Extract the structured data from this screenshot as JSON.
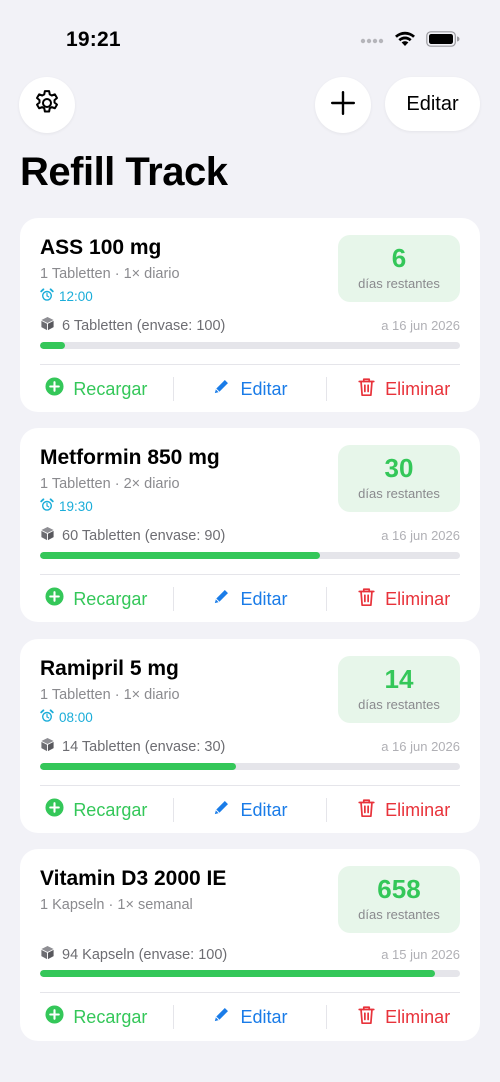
{
  "status_bar": {
    "time": "19:21"
  },
  "header": {
    "settings_icon": "gear-icon",
    "add_icon": "plus-icon",
    "edit_label": "Editar",
    "title": "Refill Track"
  },
  "colors": {
    "accent_green": "#34c759",
    "accent_blue": "#1a7ce8",
    "accent_red": "#e8333b",
    "time_cyan": "#1badd9",
    "background": "#f2f2f7"
  },
  "actions": {
    "refill_label": "Recargar",
    "edit_label": "Editar",
    "delete_label": "Eliminar"
  },
  "medications": [
    {
      "name": "ASS 100 mg",
      "dose": "1 Tabletten · 1× diario",
      "time": "12:00",
      "days_left": "6",
      "days_label": "días restantes",
      "stock": "6 Tabletten (envase: 100)",
      "date": "a 16 jun 2026",
      "fill": 0.06
    },
    {
      "name": "Metformin 850 mg",
      "dose": "1 Tabletten · 2× diario",
      "time": "19:30",
      "days_left": "30",
      "days_label": "días restantes",
      "stock": "60 Tabletten (envase: 90)",
      "date": "a 16 jun 2026",
      "fill": 0.667
    },
    {
      "name": "Ramipril 5 mg",
      "dose": "1 Tabletten · 1× diario",
      "time": "08:00",
      "days_left": "14",
      "days_label": "días restantes",
      "stock": "14 Tabletten (envase: 30)",
      "date": "a 16 jun 2026",
      "fill": 0.467
    },
    {
      "name": "Vitamin D3 2000 IE",
      "dose": "1 Kapseln · 1× semanal",
      "days_left": "658",
      "days_label": "días restantes",
      "stock": "94 Kapseln (envase: 100)",
      "date": "a 15 jun 2026",
      "fill": 0.94
    }
  ]
}
